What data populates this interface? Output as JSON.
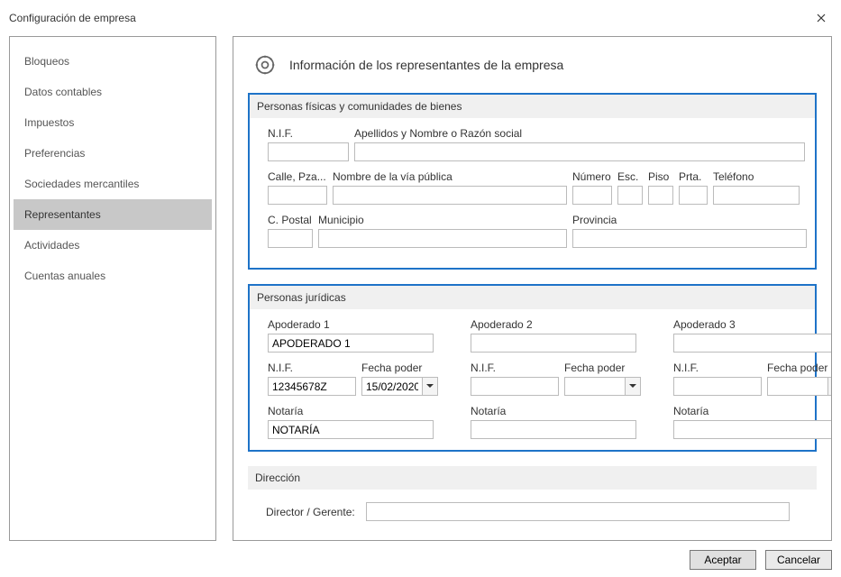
{
  "window": {
    "title": "Configuración de empresa"
  },
  "sidebar": {
    "items": [
      {
        "label": "Bloqueos"
      },
      {
        "label": "Datos contables"
      },
      {
        "label": "Impuestos"
      },
      {
        "label": "Preferencias"
      },
      {
        "label": "Sociedades mercantiles"
      },
      {
        "label": "Representantes"
      },
      {
        "label": "Actividades"
      },
      {
        "label": "Cuentas anuales"
      }
    ],
    "active_index": 5
  },
  "page": {
    "title": "Información de los representantes de la empresa"
  },
  "fisicas": {
    "title": "Personas físicas y comunidades de bienes",
    "labels": {
      "nif": "N.I.F.",
      "razon": "Apellidos y Nombre o Razón social",
      "callepza": "Calle, Pza...",
      "viapublica": "Nombre de la vía pública",
      "numero": "Número",
      "esc": "Esc.",
      "piso": "Piso",
      "prta": "Prta.",
      "telefono": "Teléfono",
      "cpostal": "C. Postal",
      "municipio": "Municipio",
      "provincia": "Provincia"
    },
    "values": {
      "nif": "",
      "razon": "",
      "callepza": "",
      "viapublica": "",
      "numero": "",
      "esc": "",
      "piso": "",
      "prta": "",
      "telefono": "",
      "cpostal": "",
      "municipio": "",
      "provincia": ""
    }
  },
  "juridicas": {
    "title": "Personas jurídicas",
    "labels": {
      "apoderado": "Apoderado",
      "nif": "N.I.F.",
      "fecha": "Fecha poder",
      "notaria": "Notaría"
    },
    "cols": [
      {
        "ap_label": "Apoderado 1",
        "ap_value": "APODERADO 1",
        "nif": "12345678Z",
        "fecha": "15/02/2020",
        "notaria": "NOTARÍA"
      },
      {
        "ap_label": "Apoderado 2",
        "ap_value": "",
        "nif": "",
        "fecha": "",
        "notaria": ""
      },
      {
        "ap_label": "Apoderado 3",
        "ap_value": "",
        "nif": "",
        "fecha": "",
        "notaria": ""
      }
    ]
  },
  "direccion": {
    "title": "Dirección",
    "director_label": "Director / Gerente:",
    "director_value": ""
  },
  "buttons": {
    "accept": "Aceptar",
    "cancel": "Cancelar"
  }
}
